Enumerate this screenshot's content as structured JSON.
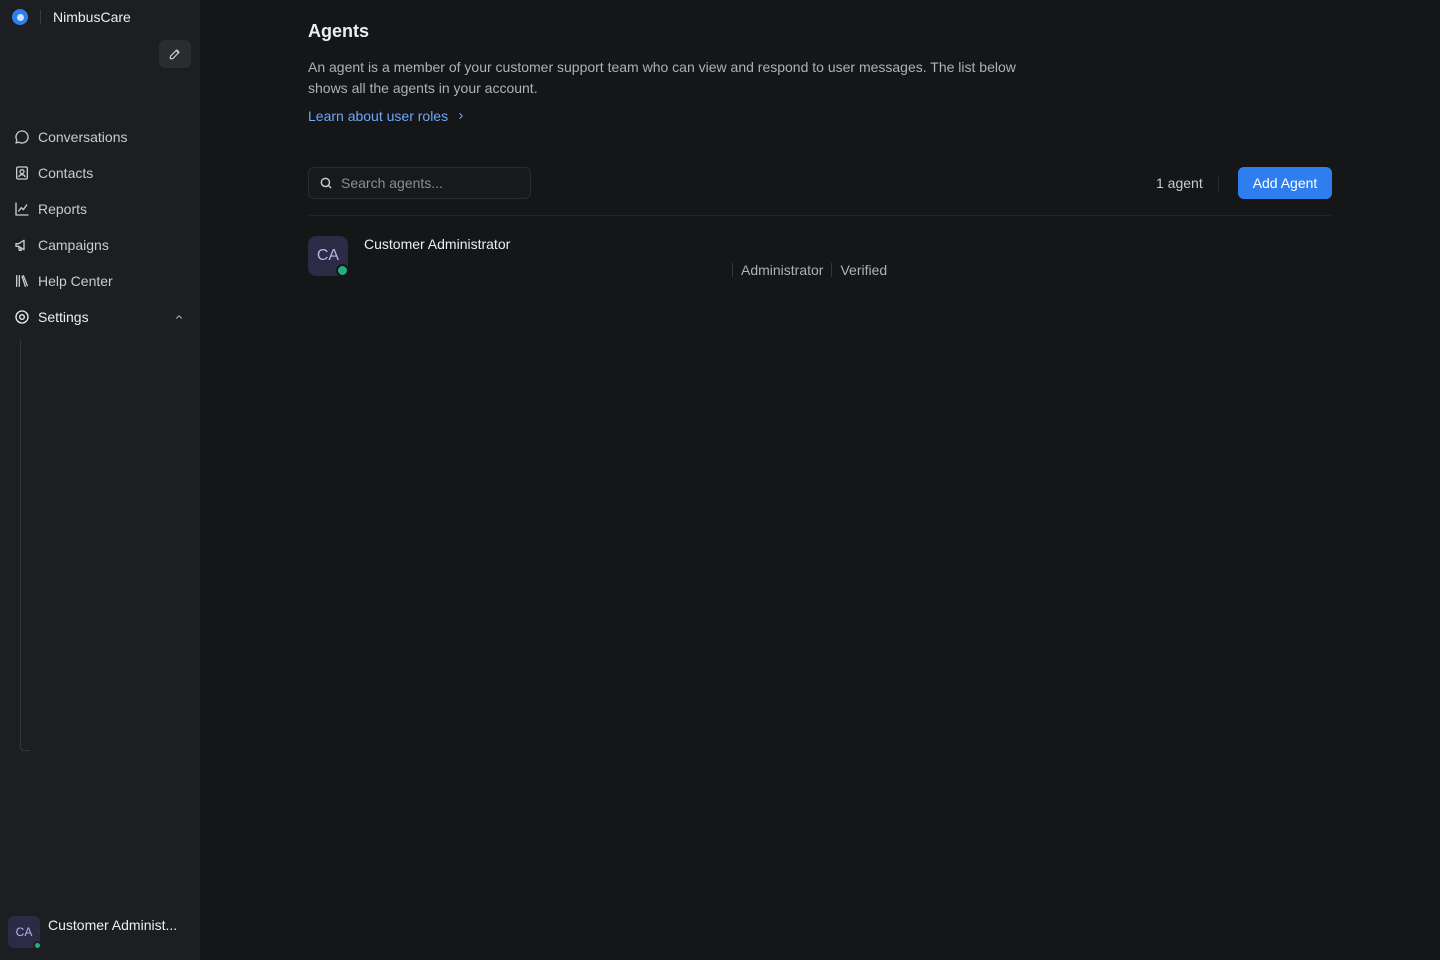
{
  "brand": {
    "name": "NimbusCare"
  },
  "sidebar": {
    "items": [
      {
        "label": "Conversations",
        "icon": "chat-bubble-icon"
      },
      {
        "label": "Contacts",
        "icon": "contact-card-icon"
      },
      {
        "label": "Reports",
        "icon": "line-chart-icon"
      },
      {
        "label": "Campaigns",
        "icon": "megaphone-icon"
      },
      {
        "label": "Help Center",
        "icon": "library-books-icon"
      },
      {
        "label": "Settings",
        "icon": "gear-icon",
        "expanded": true
      }
    ],
    "user": {
      "initials": "CA",
      "name": "Customer Administ...",
      "status": "online"
    }
  },
  "page": {
    "title": "Agents",
    "description": "An agent is a member of your customer support team who can view and respond to user messages. The list below shows all the agents in your account.",
    "learn_link": "Learn about user roles"
  },
  "toolbar": {
    "search_placeholder": "Search agents...",
    "search_value": "",
    "agent_count": "1 agent",
    "add_label": "Add Agent"
  },
  "agents": [
    {
      "initials": "CA",
      "name": "Customer Administrator",
      "email": "",
      "role": "Administrator",
      "verification": "Verified",
      "status": "online"
    }
  ],
  "colors": {
    "accent": "#2f7ef0",
    "link": "#6ea7f5",
    "online": "#22b07d",
    "sidebar_bg": "#1d1e21",
    "main_bg": "#151618"
  }
}
